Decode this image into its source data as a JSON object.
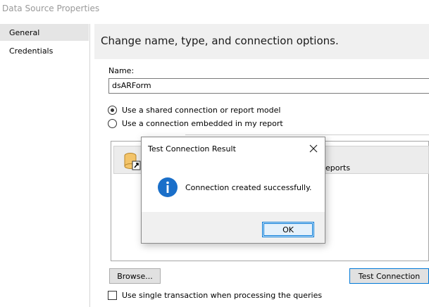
{
  "window": {
    "title": "Data Source Properties"
  },
  "sidebar": {
    "items": [
      {
        "label": "General",
        "selected": true
      },
      {
        "label": "Credentials",
        "selected": false
      }
    ]
  },
  "header": {
    "title": "Change name, type, and connection options."
  },
  "name_field": {
    "label": "Name:",
    "value": "dsARForm"
  },
  "connection": {
    "shared_label": "Use a shared connection or report model",
    "embedded_label": "Use a connection embedded in my report",
    "selected": "shared"
  },
  "list": {
    "row_text": "eports"
  },
  "buttons": {
    "browse": "Browse...",
    "test_connection": "Test Connection"
  },
  "checkbox": {
    "label": "Use single transaction when processing the queries",
    "checked": false
  },
  "dialog": {
    "title": "Test Connection Result",
    "message": "Connection created successfully.",
    "ok_label": "OK",
    "icon": "info-icon"
  },
  "colors": {
    "accent": "#0078d7",
    "info_icon": "#1a6fc9",
    "header_bg": "#f0f0f0",
    "selected_bg": "#e5e5e5"
  }
}
